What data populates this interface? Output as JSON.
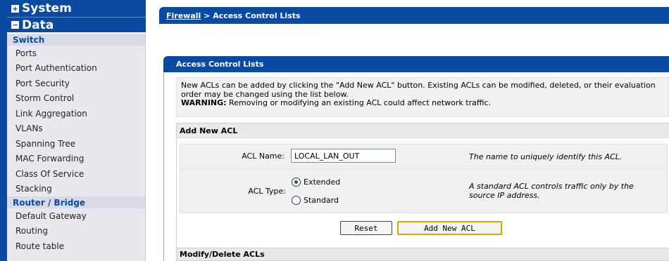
{
  "sidebar": {
    "system_label": "System",
    "data_label": "Data",
    "groups": [
      {
        "title": "Switch",
        "items": [
          "Ports",
          "Port Authentication",
          "Port Security",
          "Storm Control",
          "Link Aggregation",
          "VLANs",
          "Spanning Tree",
          "MAC Forwarding",
          "Class Of Service",
          "Stacking"
        ]
      },
      {
        "title": "Router / Bridge",
        "items": [
          "Default Gateway",
          "Routing",
          "Route table"
        ]
      }
    ]
  },
  "breadcrumb": {
    "link": "Firewall",
    "separator": " > ",
    "current": "Access Control Lists"
  },
  "panel": {
    "title": "Access Control Lists",
    "description": "New ACLs can be added by clicking the \"Add New ACL\" button. Existing ACLs can be modified, deleted, or their evaluation order may be changed using the list below.",
    "warning_label": "WARNING:",
    "warning_text": " Removing or modifying an existing ACL could affect network traffic."
  },
  "add_acl": {
    "heading": "Add New ACL",
    "name_label": "ACL Name:",
    "name_value": "LOCAL_LAN_OUT",
    "name_hint": "The name to uniquely identify this ACL.",
    "type_label": "ACL Type:",
    "type_options": [
      "Extended",
      "Standard"
    ],
    "type_selected": "Extended",
    "type_hint": "A standard ACL controls traffic only by the source IP address.",
    "reset_label": "Reset",
    "add_label": "Add New ACL"
  },
  "modify": {
    "heading": "Modify/Delete ACLs"
  },
  "colors": {
    "brand_blue": "#0a4aa0",
    "panel_gray": "#f1f1f1",
    "focus_gold": "#d8a800"
  }
}
